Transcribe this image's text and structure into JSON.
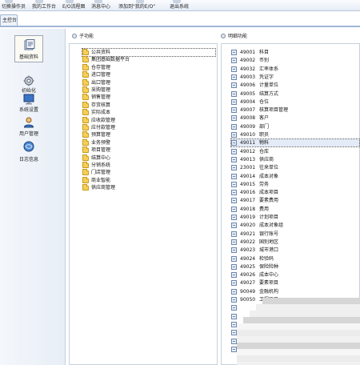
{
  "toolbar": {
    "items": [
      {
        "label": "切换操作员"
      },
      {
        "label": "我的工作台"
      },
      {
        "label": "E/O流程图"
      },
      {
        "label": "消息中心"
      },
      {
        "label": "添加到\"我的E/O\""
      },
      {
        "label": "退出系统"
      }
    ]
  },
  "tabs": [
    {
      "label": "主控台"
    }
  ],
  "sidebar": {
    "items": [
      {
        "label": "基础资料",
        "icon": "basic-data-icon",
        "active": true
      },
      {
        "label": "初始化",
        "icon": "initialize-icon",
        "active": false
      },
      {
        "label": "系统设置",
        "icon": "system-settings-icon",
        "active": false
      },
      {
        "label": "用户管理",
        "icon": "user-management-icon",
        "active": false
      },
      {
        "label": "日志信息",
        "icon": "log-info-icon",
        "active": false
      }
    ]
  },
  "sub_panel": {
    "title": "子功能",
    "folders": [
      {
        "label": "公共资料",
        "selected": true
      },
      {
        "label": "集团基础数据平台"
      },
      {
        "label": "仓存管理"
      },
      {
        "label": "进口管理"
      },
      {
        "label": "出口管理"
      },
      {
        "label": "采购管理"
      },
      {
        "label": "销售管理"
      },
      {
        "label": "存货核算"
      },
      {
        "label": "实际成本"
      },
      {
        "label": "应收款管理"
      },
      {
        "label": "应付款管理"
      },
      {
        "label": "预算管理"
      },
      {
        "label": "业务预警"
      },
      {
        "label": "项目管理"
      },
      {
        "label": "结算中心"
      },
      {
        "label": "分销系统"
      },
      {
        "label": "门店管理"
      },
      {
        "label": "商业智能"
      },
      {
        "label": "供应商管理"
      }
    ]
  },
  "detail_panel": {
    "title": "明细功能",
    "items": [
      {
        "code": "49001",
        "name": "科目"
      },
      {
        "code": "49002",
        "name": "币别"
      },
      {
        "code": "49032",
        "name": "汇率体系"
      },
      {
        "code": "49003",
        "name": "凭证字"
      },
      {
        "code": "49006",
        "name": "计量单位"
      },
      {
        "code": "49005",
        "name": "结算方式"
      },
      {
        "code": "49004",
        "name": "仓位"
      },
      {
        "code": "49007",
        "name": "核算项目管理"
      },
      {
        "code": "49008",
        "name": "客户"
      },
      {
        "code": "49009",
        "name": "部门"
      },
      {
        "code": "49010",
        "name": "职员"
      },
      {
        "code": "49011",
        "name": "物料",
        "selected": true
      },
      {
        "code": "49012",
        "name": "仓库"
      },
      {
        "code": "49013",
        "name": "供应商"
      },
      {
        "code": "23001",
        "name": "往来单位"
      },
      {
        "code": "49014",
        "name": "成本对象"
      },
      {
        "code": "49015",
        "name": "劳务"
      },
      {
        "code": "49016",
        "name": "成本项目"
      },
      {
        "code": "49017",
        "name": "要素费用"
      },
      {
        "code": "49018",
        "name": "费用"
      },
      {
        "code": "49019",
        "name": "计划项目"
      },
      {
        "code": "49020",
        "name": "成本对象组"
      },
      {
        "code": "49021",
        "name": "银行账号"
      },
      {
        "code": "49022",
        "name": "国别地区"
      },
      {
        "code": "49023",
        "name": "城市港口"
      },
      {
        "code": "49024",
        "name": "检验码"
      },
      {
        "code": "49025",
        "name": "保险险种"
      },
      {
        "code": "49026",
        "name": "成本中心"
      },
      {
        "code": "49027",
        "name": "要素项目"
      },
      {
        "code": "90049",
        "name": "金融机构"
      },
      {
        "code": "90050",
        "name": "工程项目"
      }
    ]
  }
}
